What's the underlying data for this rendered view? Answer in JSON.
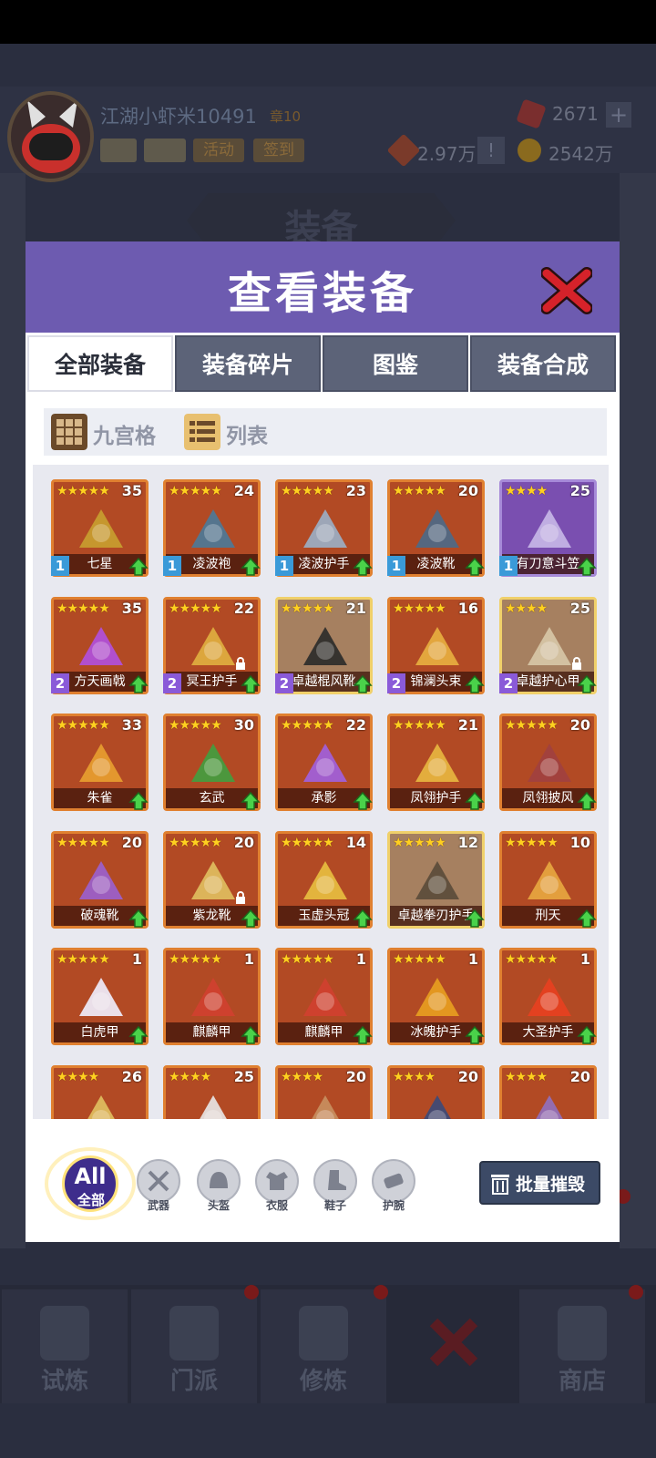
{
  "player": {
    "name": "江湖小虾米10491",
    "level": "章10",
    "buttons": [
      "活动",
      "签到"
    ]
  },
  "resources": {
    "gems": "2671",
    "power": "2.97万",
    "coins": "2542万"
  },
  "background_banner": "装备",
  "panel": {
    "title": "查看装备"
  },
  "tabs": [
    "全部装备",
    "装备碎片",
    "图鉴",
    "装备合成"
  ],
  "views": {
    "grid": "九宫格",
    "list": "列表"
  },
  "items": [
    {
      "name": "七星",
      "level": "35",
      "stars": "★★★★★",
      "num": "1"
    },
    {
      "name": "凌波袍",
      "level": "24",
      "stars": "★★★★★",
      "num": "1"
    },
    {
      "name": "凌波护手",
      "level": "23",
      "stars": "★★★★★",
      "num": "1"
    },
    {
      "name": "凌波靴",
      "level": "20",
      "stars": "★★★★★",
      "num": "1"
    },
    {
      "name": "有刀意斗笠",
      "level": "25",
      "stars": "★★★★",
      "num": "1"
    },
    {
      "name": "方天画戟",
      "level": "35",
      "stars": "★★★★★",
      "num": "2"
    },
    {
      "name": "冥王护手",
      "level": "22",
      "stars": "★★★★★",
      "num": "2"
    },
    {
      "name": "卓越棍风靴",
      "level": "21",
      "stars": "★★★★★",
      "num": "2"
    },
    {
      "name": "锦澜头束",
      "level": "16",
      "stars": "★★★★★",
      "num": "2"
    },
    {
      "name": "卓越护心甲",
      "level": "25",
      "stars": "★★★★",
      "num": "2"
    },
    {
      "name": "朱雀",
      "level": "33",
      "stars": "★★★★★",
      "num": ""
    },
    {
      "name": "玄武",
      "level": "30",
      "stars": "★★★★★",
      "num": ""
    },
    {
      "name": "承影",
      "level": "22",
      "stars": "★★★★★",
      "num": ""
    },
    {
      "name": "凤翎护手",
      "level": "21",
      "stars": "★★★★★",
      "num": ""
    },
    {
      "name": "凤翎披风",
      "level": "20",
      "stars": "★★★★★",
      "num": ""
    },
    {
      "name": "破魂靴",
      "level": "20",
      "stars": "★★★★★",
      "num": ""
    },
    {
      "name": "紫龙靴",
      "level": "20",
      "stars": "★★★★★",
      "num": ""
    },
    {
      "name": "玉虚头冠",
      "level": "14",
      "stars": "★★★★★",
      "num": ""
    },
    {
      "name": "卓越拳刃护手",
      "level": "12",
      "stars": "★★★★★",
      "num": ""
    },
    {
      "name": "刑天",
      "level": "10",
      "stars": "★★★★★",
      "num": ""
    },
    {
      "name": "白虎甲",
      "level": "1",
      "stars": "★★★★★",
      "num": ""
    },
    {
      "name": "麒麟甲",
      "level": "1",
      "stars": "★★★★★",
      "num": ""
    },
    {
      "name": "麒麟甲",
      "level": "1",
      "stars": "★★★★★",
      "num": ""
    },
    {
      "name": "冰魄护手",
      "level": "1",
      "stars": "★★★★★",
      "num": ""
    },
    {
      "name": "大圣护手",
      "level": "1",
      "stars": "★★★★★",
      "num": ""
    },
    {
      "name": "",
      "level": "26",
      "stars": "★★★★",
      "num": ""
    },
    {
      "name": "",
      "level": "25",
      "stars": "★★★★",
      "num": ""
    },
    {
      "name": "",
      "level": "20",
      "stars": "★★★★",
      "num": ""
    },
    {
      "name": "",
      "level": "20",
      "stars": "★★★★",
      "num": ""
    },
    {
      "name": "",
      "level": "20",
      "stars": "★★★★",
      "num": ""
    }
  ],
  "filters": {
    "all_top": "All",
    "all_bottom": "全部",
    "list": [
      "武器",
      "头盔",
      "衣服",
      "鞋子",
      "护腕"
    ]
  },
  "bulk_button": "批量摧毁",
  "nav": [
    "试炼",
    "门派",
    "修炼",
    "",
    "商店"
  ],
  "colors": {
    "panel_title": "#6d5bb0",
    "card_orange": "#b24a24",
    "card_purple": "#7a4fb0",
    "card_tan": "#a68060",
    "star": "#ffd020",
    "all_button": "#3e2d8c"
  }
}
